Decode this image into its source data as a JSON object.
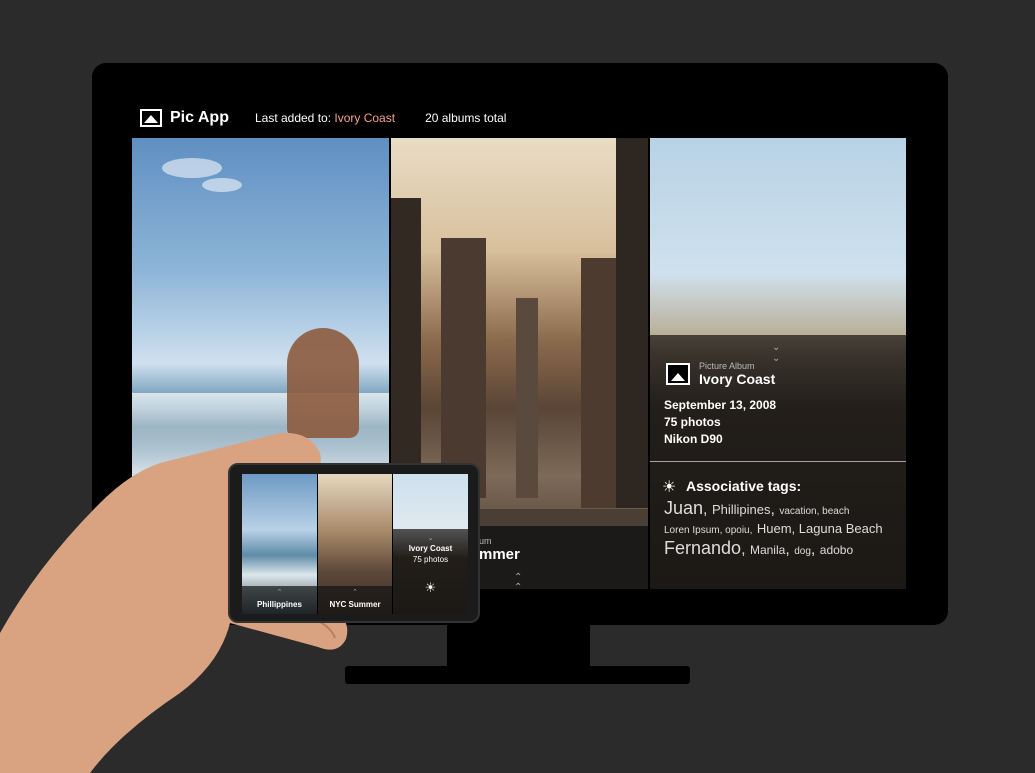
{
  "app": {
    "title": "Pic App",
    "last_added_prefix": "Last added to:",
    "last_added_album": "Ivory Coast",
    "albums_total": "20 albums total"
  },
  "panels": {
    "middle": {
      "caption_small": "um",
      "caption_title": "mmer"
    },
    "right": {
      "album_type": "Picture Album",
      "album_name": "Ivory Coast",
      "date": "September 13, 2008",
      "photos": "75 photos",
      "camera": "Nikon D90",
      "tags_title": "Associative tags:",
      "tags": {
        "line1": {
          "big": "Juan",
          "mid": "Phillipines",
          "small": "vacation, beach"
        },
        "line2": {
          "small": "Loren Ipsum, opoiu,",
          "mid": "Huem, Laguna Beach"
        },
        "line3": {
          "big": "Fernando",
          "mid": "Manila",
          "small": "dog",
          "mid2": "adobo"
        }
      }
    }
  },
  "phone": {
    "panels": [
      {
        "label": "Phillippines"
      },
      {
        "label": "NYC Summer"
      },
      {
        "name": "Ivory Coast",
        "photos": "75 photos"
      }
    ]
  },
  "icons": {
    "app": "image-icon",
    "album": "image-icon",
    "tags": "sun-icon",
    "collapse": "chevron-down-icon",
    "expand": "chevron-up-icon"
  },
  "colors": {
    "accent": "#f4a28c",
    "background": "#2b2b2b",
    "tv_frame": "#000000"
  }
}
